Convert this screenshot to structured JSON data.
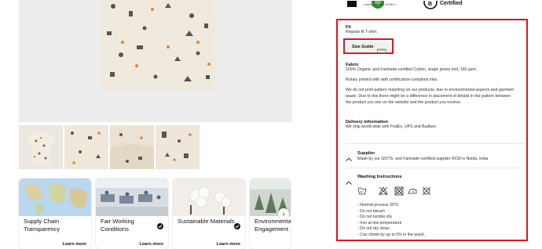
{
  "product": {
    "thumbnails": [
      "thumb-front",
      "thumb-detail-1",
      "thumb-detail-2",
      "thumb-detail-3"
    ]
  },
  "impact_cards": [
    {
      "title": "Supply Chain Transparency",
      "link": "Learn more"
    },
    {
      "title": "Fair Working Conditions",
      "link": "Learn more",
      "badge": "check-badge-icon"
    },
    {
      "title": "Sustainable Materials",
      "link": "Learn more",
      "badge": "check-badge-icon"
    },
    {
      "title": "Environmental Engagement",
      "link": ""
    }
  ],
  "certifications": {
    "license": "License Number 10 594 1",
    "bcorp": "Certified"
  },
  "details": {
    "fit_label": "Fit",
    "fit_text": "Regular fit T-shirt.",
    "size_guide_label": "Size Guide",
    "fabric_label": "Fabric",
    "fabric_text": "100% Organic and Fairtrade-certified Cotton, single jersey knit, 160 gsm.",
    "print_text": "Rotary printed with with certification-compliant inks.",
    "placement_text_1": "We do not print pattern matching on our products, due to environmental aspects and garment",
    "placement_text_2": "waste. Due to this there might be a difference in placement of details in the pattern between",
    "placement_text_3": "the product you see on the website and the product you receive.",
    "delivery_label": "Delivery information",
    "delivery_text": "We ship world-wide with FedEx, UPS and Budbee.",
    "supplier_label": "Supplier",
    "supplier_text": "Made by our GOTS- and Fairtrade-certified supplier RCM in Noida, India",
    "washing_label": "Washing Instructions",
    "care": [
      "- Normal process 30°C",
      "- Do not bleach",
      "- Do not tumble dry",
      "- Iron at low temperature",
      "- Do not dry clean",
      "- Can shrink by up to 5% in the wash."
    ],
    "wash_icons": [
      "wash-30-icon",
      "no-bleach-icon",
      "no-tumble-dry-icon",
      "iron-low-icon",
      "no-dry-clean-icon"
    ]
  },
  "colors": {
    "highlight": "#e0141e",
    "accent_green": "#2e8b3a"
  }
}
